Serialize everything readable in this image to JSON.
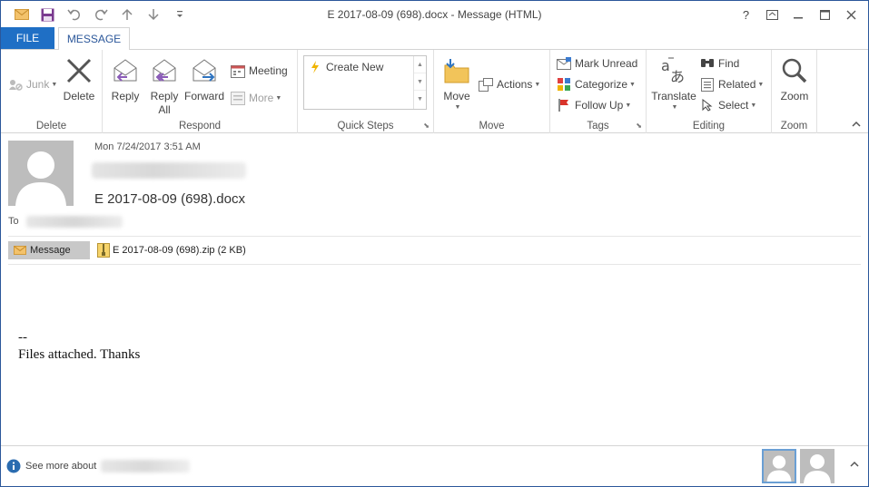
{
  "window": {
    "title": "E 2017-08-09 (698).docx - Message (HTML)",
    "controls": {
      "help": "?",
      "restore_ribbon": "⊡",
      "minimize": "—",
      "maximize": "☐",
      "close": "✕"
    }
  },
  "qat": {
    "icons": [
      "envelope-icon",
      "save-icon",
      "undo-icon",
      "redo-icon",
      "up-arrow-icon",
      "down-arrow-icon",
      "customize-icon"
    ]
  },
  "tabs": {
    "file": "FILE",
    "message": "MESSAGE"
  },
  "ribbon": {
    "delete_group": {
      "label": "Delete",
      "junk": "Junk",
      "delete": "Delete"
    },
    "respond_group": {
      "label": "Respond",
      "reply": "Reply",
      "reply_all_1": "Reply",
      "reply_all_2": "All",
      "forward": "Forward",
      "meeting": "Meeting",
      "more": "More"
    },
    "quick_steps_group": {
      "label": "Quick Steps",
      "create_new": "Create New"
    },
    "move_group": {
      "label": "Move",
      "move": "Move",
      "actions": "Actions"
    },
    "tags_group": {
      "label": "Tags",
      "mark_unread": "Mark Unread",
      "categorize": "Categorize",
      "follow_up": "Follow Up"
    },
    "editing_group": {
      "label": "Editing",
      "translate": "Translate",
      "find": "Find",
      "related": "Related",
      "select": "Select"
    },
    "zoom_group": {
      "label": "Zoom",
      "zoom": "Zoom"
    }
  },
  "message": {
    "date": "Mon 7/24/2017 3:51 AM",
    "subject": "E 2017-08-09 (698).docx",
    "to_label": "To",
    "message_tab": "Message",
    "attachment": "E 2017-08-09 (698).zip (2 KB)",
    "body_line1": "--",
    "body_line2": "Files attached. Thanks"
  },
  "footer": {
    "see_more": "See more about"
  },
  "colors": {
    "accent": "#2b579a",
    "file_tab": "#1f6fc5"
  }
}
